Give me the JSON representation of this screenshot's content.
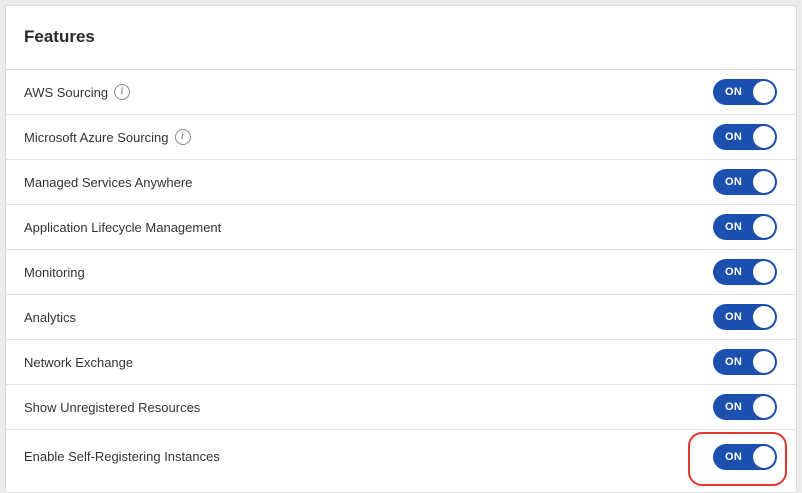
{
  "panel": {
    "title": "Features"
  },
  "colors": {
    "toggle_on": "#1b4fb0",
    "highlight": "#e0392b"
  },
  "features": [
    {
      "label": "AWS Sourcing",
      "has_info": true,
      "info_icon": "info-icon",
      "state": "ON"
    },
    {
      "label": "Microsoft Azure Sourcing",
      "has_info": true,
      "info_icon": "info-icon",
      "state": "ON"
    },
    {
      "label": "Managed Services Anywhere",
      "has_info": false,
      "state": "ON"
    },
    {
      "label": "Application Lifecycle Management",
      "has_info": false,
      "state": "ON"
    },
    {
      "label": "Monitoring",
      "has_info": false,
      "state": "ON"
    },
    {
      "label": "Analytics",
      "has_info": false,
      "state": "ON"
    },
    {
      "label": "Network Exchange",
      "has_info": false,
      "state": "ON"
    },
    {
      "label": "Show Unregistered Resources",
      "has_info": false,
      "state": "ON"
    },
    {
      "label": "Enable Self-Registering Instances",
      "has_info": false,
      "state": "ON",
      "highlighted": true
    }
  ]
}
